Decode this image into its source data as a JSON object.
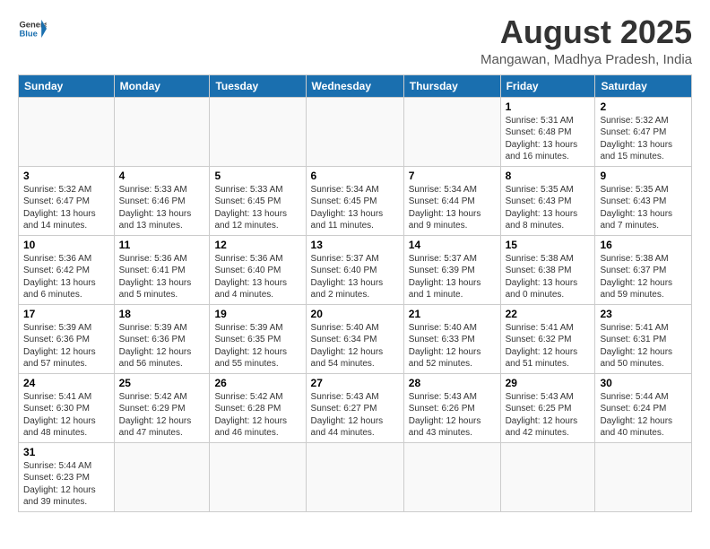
{
  "header": {
    "logo_general": "General",
    "logo_blue": "Blue",
    "title": "August 2025",
    "subtitle": "Mangawan, Madhya Pradesh, India"
  },
  "weekdays": [
    "Sunday",
    "Monday",
    "Tuesday",
    "Wednesday",
    "Thursday",
    "Friday",
    "Saturday"
  ],
  "weeks": [
    [
      {
        "day": "",
        "info": ""
      },
      {
        "day": "",
        "info": ""
      },
      {
        "day": "",
        "info": ""
      },
      {
        "day": "",
        "info": ""
      },
      {
        "day": "",
        "info": ""
      },
      {
        "day": "1",
        "info": "Sunrise: 5:31 AM\nSunset: 6:48 PM\nDaylight: 13 hours and 16 minutes."
      },
      {
        "day": "2",
        "info": "Sunrise: 5:32 AM\nSunset: 6:47 PM\nDaylight: 13 hours and 15 minutes."
      }
    ],
    [
      {
        "day": "3",
        "info": "Sunrise: 5:32 AM\nSunset: 6:47 PM\nDaylight: 13 hours and 14 minutes."
      },
      {
        "day": "4",
        "info": "Sunrise: 5:33 AM\nSunset: 6:46 PM\nDaylight: 13 hours and 13 minutes."
      },
      {
        "day": "5",
        "info": "Sunrise: 5:33 AM\nSunset: 6:45 PM\nDaylight: 13 hours and 12 minutes."
      },
      {
        "day": "6",
        "info": "Sunrise: 5:34 AM\nSunset: 6:45 PM\nDaylight: 13 hours and 11 minutes."
      },
      {
        "day": "7",
        "info": "Sunrise: 5:34 AM\nSunset: 6:44 PM\nDaylight: 13 hours and 9 minutes."
      },
      {
        "day": "8",
        "info": "Sunrise: 5:35 AM\nSunset: 6:43 PM\nDaylight: 13 hours and 8 minutes."
      },
      {
        "day": "9",
        "info": "Sunrise: 5:35 AM\nSunset: 6:43 PM\nDaylight: 13 hours and 7 minutes."
      }
    ],
    [
      {
        "day": "10",
        "info": "Sunrise: 5:36 AM\nSunset: 6:42 PM\nDaylight: 13 hours and 6 minutes."
      },
      {
        "day": "11",
        "info": "Sunrise: 5:36 AM\nSunset: 6:41 PM\nDaylight: 13 hours and 5 minutes."
      },
      {
        "day": "12",
        "info": "Sunrise: 5:36 AM\nSunset: 6:40 PM\nDaylight: 13 hours and 4 minutes."
      },
      {
        "day": "13",
        "info": "Sunrise: 5:37 AM\nSunset: 6:40 PM\nDaylight: 13 hours and 2 minutes."
      },
      {
        "day": "14",
        "info": "Sunrise: 5:37 AM\nSunset: 6:39 PM\nDaylight: 13 hours and 1 minute."
      },
      {
        "day": "15",
        "info": "Sunrise: 5:38 AM\nSunset: 6:38 PM\nDaylight: 13 hours and 0 minutes."
      },
      {
        "day": "16",
        "info": "Sunrise: 5:38 AM\nSunset: 6:37 PM\nDaylight: 12 hours and 59 minutes."
      }
    ],
    [
      {
        "day": "17",
        "info": "Sunrise: 5:39 AM\nSunset: 6:36 PM\nDaylight: 12 hours and 57 minutes."
      },
      {
        "day": "18",
        "info": "Sunrise: 5:39 AM\nSunset: 6:36 PM\nDaylight: 12 hours and 56 minutes."
      },
      {
        "day": "19",
        "info": "Sunrise: 5:39 AM\nSunset: 6:35 PM\nDaylight: 12 hours and 55 minutes."
      },
      {
        "day": "20",
        "info": "Sunrise: 5:40 AM\nSunset: 6:34 PM\nDaylight: 12 hours and 54 minutes."
      },
      {
        "day": "21",
        "info": "Sunrise: 5:40 AM\nSunset: 6:33 PM\nDaylight: 12 hours and 52 minutes."
      },
      {
        "day": "22",
        "info": "Sunrise: 5:41 AM\nSunset: 6:32 PM\nDaylight: 12 hours and 51 minutes."
      },
      {
        "day": "23",
        "info": "Sunrise: 5:41 AM\nSunset: 6:31 PM\nDaylight: 12 hours and 50 minutes."
      }
    ],
    [
      {
        "day": "24",
        "info": "Sunrise: 5:41 AM\nSunset: 6:30 PM\nDaylight: 12 hours and 48 minutes."
      },
      {
        "day": "25",
        "info": "Sunrise: 5:42 AM\nSunset: 6:29 PM\nDaylight: 12 hours and 47 minutes."
      },
      {
        "day": "26",
        "info": "Sunrise: 5:42 AM\nSunset: 6:28 PM\nDaylight: 12 hours and 46 minutes."
      },
      {
        "day": "27",
        "info": "Sunrise: 5:43 AM\nSunset: 6:27 PM\nDaylight: 12 hours and 44 minutes."
      },
      {
        "day": "28",
        "info": "Sunrise: 5:43 AM\nSunset: 6:26 PM\nDaylight: 12 hours and 43 minutes."
      },
      {
        "day": "29",
        "info": "Sunrise: 5:43 AM\nSunset: 6:25 PM\nDaylight: 12 hours and 42 minutes."
      },
      {
        "day": "30",
        "info": "Sunrise: 5:44 AM\nSunset: 6:24 PM\nDaylight: 12 hours and 40 minutes."
      }
    ],
    [
      {
        "day": "31",
        "info": "Sunrise: 5:44 AM\nSunset: 6:23 PM\nDaylight: 12 hours and 39 minutes."
      },
      {
        "day": "",
        "info": ""
      },
      {
        "day": "",
        "info": ""
      },
      {
        "day": "",
        "info": ""
      },
      {
        "day": "",
        "info": ""
      },
      {
        "day": "",
        "info": ""
      },
      {
        "day": "",
        "info": ""
      }
    ]
  ]
}
